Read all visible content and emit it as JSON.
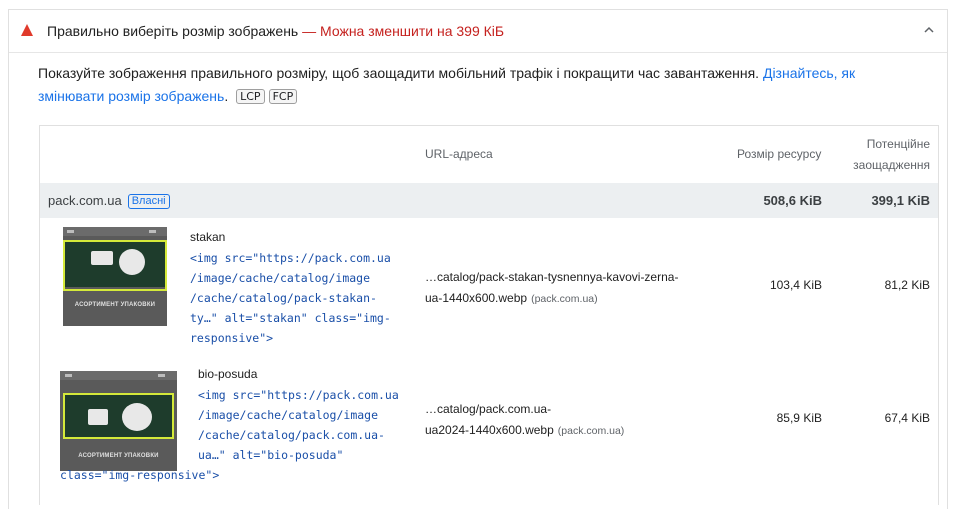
{
  "audit": {
    "title": "Правильно виберіть розмір зображень",
    "savings": "— Можна зменшити на 399 КіБ",
    "status_color": "#e03a2b",
    "icon": "fail-triangle-icon"
  },
  "description": {
    "text": "Показуйте зображення правильного розміру, щоб заощадити мобільний трафік і покращити час завантаження. ",
    "link": "Дізнайтесь, як змінювати розмір зображень",
    "period": ".",
    "chips": [
      "LCP",
      "FCP"
    ]
  },
  "table": {
    "headers": {
      "url": "URL-адреса",
      "size": "Розмір ресурсу",
      "savings_line1": "Потенційне",
      "savings_line2": "заощадження"
    },
    "group": {
      "name": "pack.com.ua",
      "badge": "Власні",
      "size": "508,6 KiB",
      "savings": "399,1 KiB"
    },
    "rows": [
      {
        "label": "stakan",
        "snippet_lines": [
          "<img src=\"https://pack.com.ua",
          "/image/cache/catalog/image",
          "/cache/catalog/pack-stakan-",
          "ty…\" alt=\"stakan\" class=\"img-",
          "responsive\">"
        ],
        "url_line1": "…catalog/pack-stakan-tysnennya-kavovi-zerna-",
        "url_line2": "ua-1440x600.webp",
        "origin": "(pack.com.ua)",
        "size": "103,4 KiB",
        "savings": "81,2 KiB",
        "thumb_caption": "АСОРТИМЕНТ УПАКОВКИ"
      },
      {
        "label": "bio-posuda",
        "snippet_lines": [
          "<img src=\"https://pack.com.ua",
          "/image/cache/catalog/image",
          "/cache/catalog/pack.com.ua-",
          "ua…\" alt=\"bio-posuda\"",
          "class=\"img-responsive\">"
        ],
        "url_line1": "…catalog/pack.com.ua-",
        "url_line2": "ua2024-1440x600.webp",
        "origin": "(pack.com.ua)",
        "size": "85,9 KiB",
        "savings": "67,4 KiB",
        "thumb_caption": "АСОРТИМЕНТ УПАКОВКИ"
      }
    ]
  }
}
